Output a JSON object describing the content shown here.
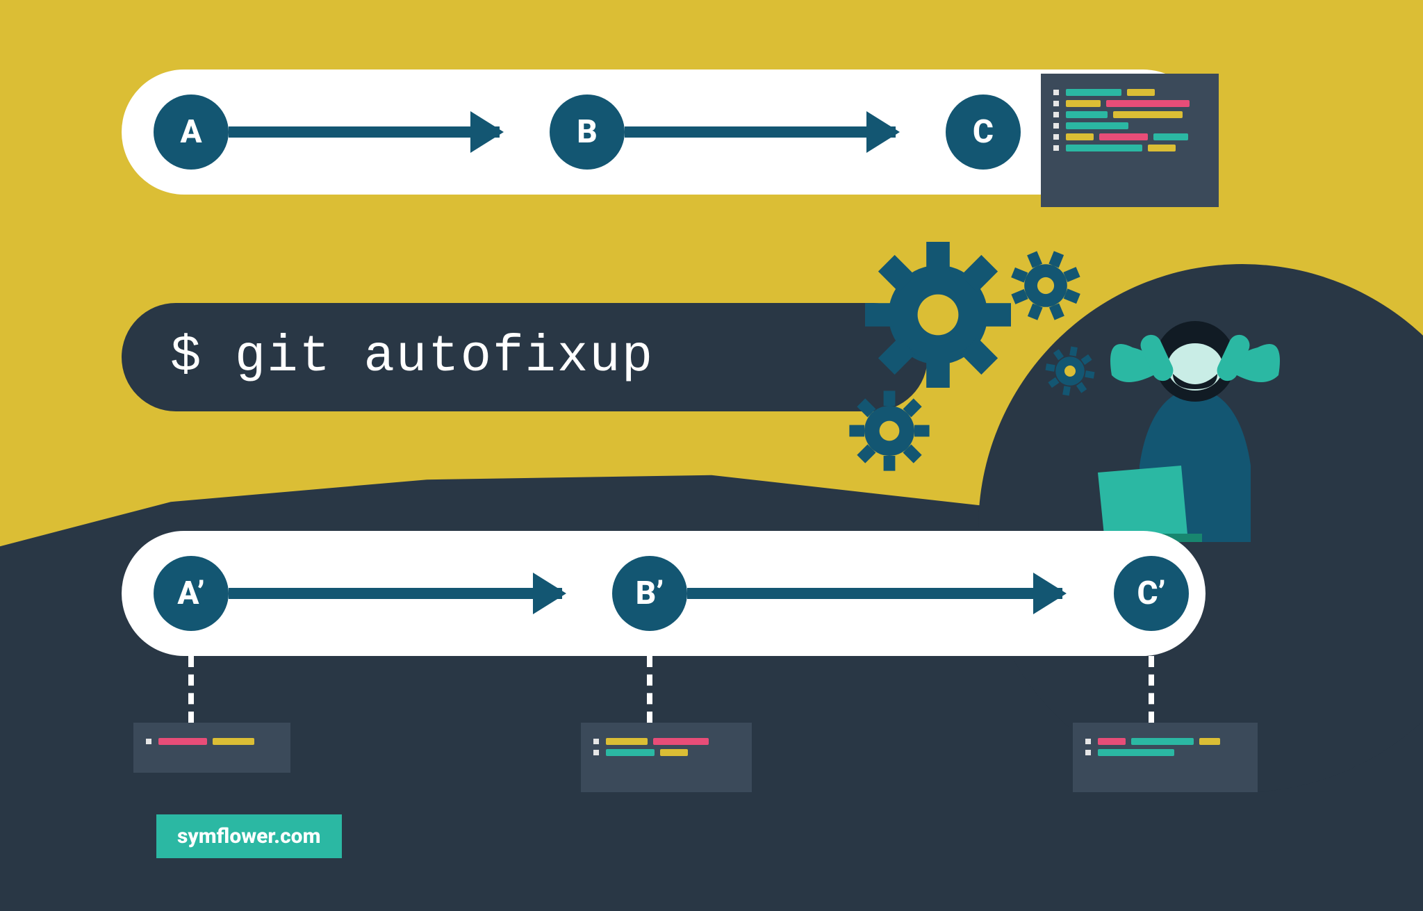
{
  "top": {
    "a": "A",
    "b": "B",
    "c": "C"
  },
  "bot": {
    "a": "A’",
    "b": "B’",
    "c": "C’"
  },
  "command": "$ git autofixup",
  "brand": "symflower.com",
  "colors": {
    "bgYellow": "#dbbe35",
    "bgDark": "#293745",
    "node": "#135672",
    "teal": "#2bb8a3",
    "pink": "#e84d78"
  }
}
